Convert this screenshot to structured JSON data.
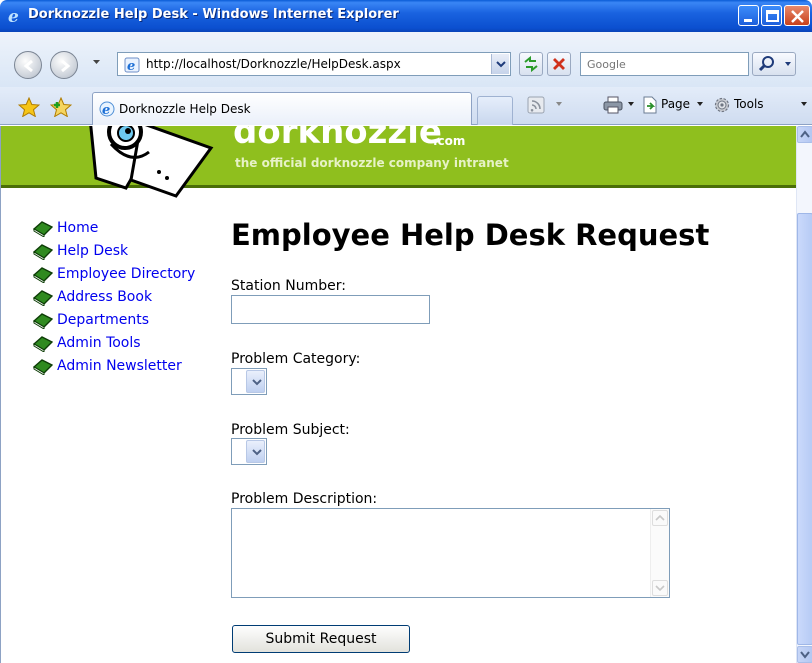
{
  "window": {
    "title": "Dorknozzle Help Desk - Windows Internet Explorer"
  },
  "address_bar": {
    "url": "http://localhost/Dorknozzle/HelpDesk.aspx",
    "search_placeholder": "Google"
  },
  "tab": {
    "label": "Dorknozzle Help Desk"
  },
  "commands": {
    "page": "Page",
    "tools": "Tools"
  },
  "banner": {
    "brand": "dorknozzle",
    "brand_suffix": ".com",
    "tagline": "the official dorknozzle company intranet",
    "color": "#8fbf1e"
  },
  "sidebar": {
    "items": [
      {
        "label": "Home"
      },
      {
        "label": "Help Desk"
      },
      {
        "label": "Employee Directory"
      },
      {
        "label": "Address Book"
      },
      {
        "label": "Departments"
      },
      {
        "label": "Admin Tools"
      },
      {
        "label": "Admin Newsletter"
      }
    ]
  },
  "form": {
    "title": "Employee Help Desk Request",
    "station_label": "Station Number:",
    "station_value": "",
    "category_label": "Problem Category:",
    "category_value": "",
    "subject_label": "Problem Subject:",
    "subject_value": "",
    "description_label": "Problem Description:",
    "description_value": "",
    "submit_label": "Submit Request"
  }
}
